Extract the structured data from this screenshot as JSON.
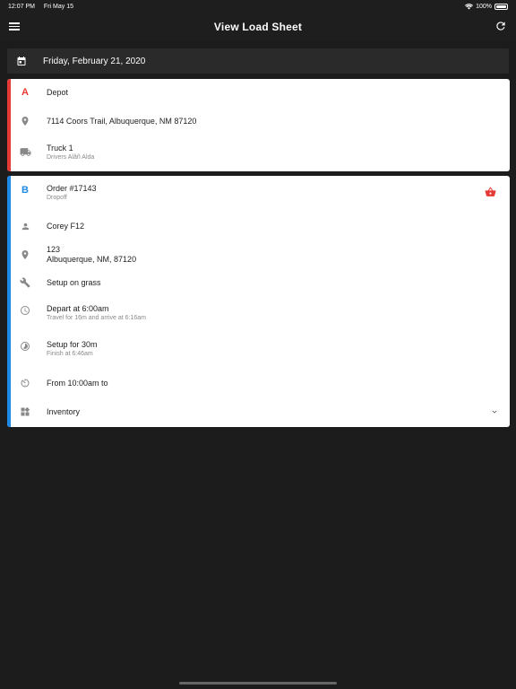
{
  "status": {
    "time": "12:07 PM",
    "date": "Fri May 15",
    "battery": "100%"
  },
  "header": {
    "title": "View Load Sheet"
  },
  "date_bar": {
    "date": "Friday, February 21, 2020"
  },
  "depot": {
    "letter": "A",
    "title": "Depot",
    "address": "7114 Coors Trail, Albuquerque, NM 87120",
    "vehicle": "Truck 1",
    "drivers": "Drivers Alâñ Alda",
    "accent": "#e53935"
  },
  "order": {
    "letter": "B",
    "title": "Order #17143",
    "type": "Dropoff",
    "customer": "Corey F12",
    "address_line1": "123",
    "address_line2": "Albuquerque, NM, 87120",
    "setup_surface": "Setup on grass",
    "depart": "Depart at 6:00am",
    "travel": "Travel for 16m and arrive at 6:16am",
    "setup_duration": "Setup for 30m",
    "finish": "Finish at 6:46am",
    "window": "From 10:00am to",
    "inventory": "Inventory",
    "accent": "#1e88e5",
    "basket_color": "#e53935"
  }
}
